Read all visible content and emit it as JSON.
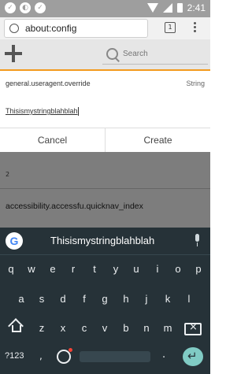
{
  "statusbar": {
    "time": "2:41"
  },
  "browser": {
    "url": "about:config",
    "tab_count": "1"
  },
  "config_header": {
    "search_placeholder": "Search"
  },
  "new_pref": {
    "name": "general.useragent.override",
    "type": "String",
    "value": "Thisismystringblahblah",
    "cancel_label": "Cancel",
    "create_label": "Create"
  },
  "pref_list": [
    {
      "value": "2"
    },
    {
      "name": "accessibility.accessfu.quicknav_index"
    }
  ],
  "keyboard": {
    "suggestion": "Thisismystringblahblah",
    "row1": [
      "q",
      "w",
      "e",
      "r",
      "t",
      "y",
      "u",
      "i",
      "o",
      "p"
    ],
    "row2": [
      "a",
      "s",
      "d",
      "f",
      "g",
      "h",
      "j",
      "k",
      "l"
    ],
    "row3": [
      "z",
      "x",
      "c",
      "v",
      "b",
      "n",
      "m"
    ],
    "symbols_label": "?123",
    "comma": ",",
    "period": "."
  }
}
